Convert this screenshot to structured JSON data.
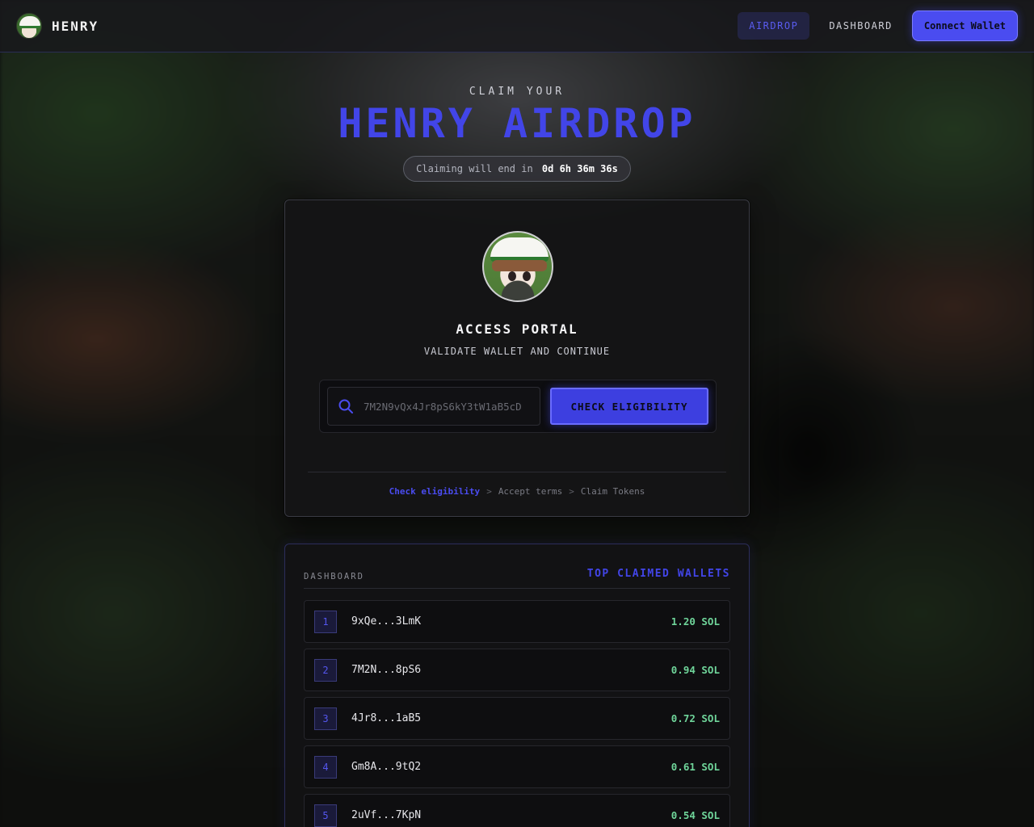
{
  "header": {
    "brand": "HENRY",
    "nav": [
      {
        "label": "AIRDROP",
        "active": true
      },
      {
        "label": "DASHBOARD",
        "active": false
      }
    ],
    "connect_wallet": "Connect Wallet"
  },
  "hero": {
    "subtitle": "CLAIM YOUR",
    "title": "HENRY AIRDROP",
    "countdown_prefix": "Claiming will end in",
    "countdown_value": "0d 6h 36m 36s"
  },
  "portal": {
    "title": "ACCESS PORTAL",
    "subtitle": "VALIDATE WALLET AND CONTINUE",
    "address_value": "7M2N9vQx4Jr8pS6kY3tW1aB5cD",
    "check_button": "CHECK ELIGIBILITY",
    "steps": [
      {
        "label": "Check eligibility",
        "current": true
      },
      {
        "label": "Accept terms",
        "current": false
      },
      {
        "label": "Claim Tokens",
        "current": false
      }
    ],
    "step_separator": ">"
  },
  "dashboard": {
    "label": "DASHBOARD",
    "title": "TOP CLAIMED WALLETS",
    "rows": [
      {
        "rank": "1",
        "wallet": "9xQe...3LmK",
        "amount": "1.20 SOL"
      },
      {
        "rank": "2",
        "wallet": "7M2N...8pS6",
        "amount": "0.94 SOL"
      },
      {
        "rank": "3",
        "wallet": "4Jr8...1aB5",
        "amount": "0.72 SOL"
      },
      {
        "rank": "4",
        "wallet": "Gm8A...9tQ2",
        "amount": "0.61 SOL"
      },
      {
        "rank": "5",
        "wallet": "2uVf...7KpN",
        "amount": "0.54 SOL"
      }
    ]
  },
  "colors": {
    "accent": "#4245e8",
    "amount": "#6fd59a",
    "nav_border": "#2a2d55"
  },
  "icons": {
    "brand": "henry-avatar-icon",
    "search": "search-icon",
    "portal": "henry-avatar-icon"
  }
}
